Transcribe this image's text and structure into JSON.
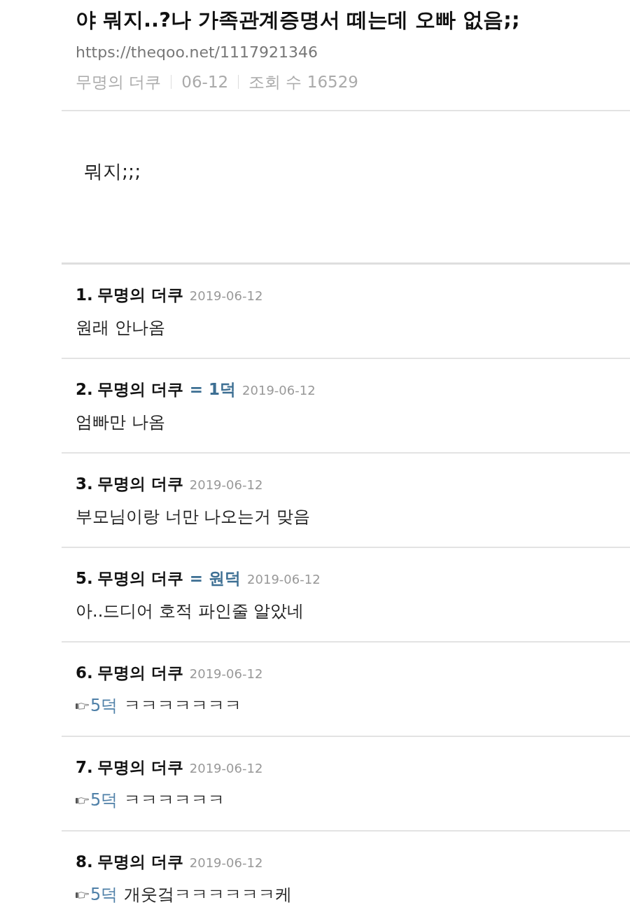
{
  "post": {
    "title": "야 뭐지..?나 가족관계증명서 떼는데 오빠 없음;;",
    "url": "https://theqoo.net/1117921346",
    "meta": [
      "무명의 더쿠",
      "06-12",
      "조회 수 16529"
    ],
    "body": "뭐지;;;"
  },
  "comments": [
    {
      "number": "1.",
      "author": "무명의 더쿠",
      "date": "2019-06-12",
      "text": "원래 안나옴"
    },
    {
      "number": "2.",
      "author": "무명의 더쿠",
      "tag": "= 1덕",
      "date": "2019-06-12",
      "text": "엄빠만 나옴"
    },
    {
      "number": "3.",
      "author": "무명의 더쿠",
      "date": "2019-06-12",
      "text": "부모님이랑 너만 나오는거 맞음"
    },
    {
      "number": "5.",
      "author": "무명의 더쿠",
      "tag": "= 원덕",
      "date": "2019-06-12",
      "text": "아..드디어 호적 파인줄 알았네"
    },
    {
      "number": "6.",
      "author": "무명의 더쿠",
      "date": "2019-06-12",
      "reply_to": "5덕",
      "text": "ㅋㅋㅋㅋㅋㅋㅋ"
    },
    {
      "number": "7.",
      "author": "무명의 더쿠",
      "date": "2019-06-12",
      "reply_to": "5덕",
      "text": "ㅋㅋㅋㅋㅋㅋ"
    },
    {
      "number": "8.",
      "author": "무명의 더쿠",
      "date": "2019-06-12",
      "reply_to": "5덕",
      "text": "개웃겈ㅋㅋㅋㅋㅋㅋ케"
    }
  ]
}
